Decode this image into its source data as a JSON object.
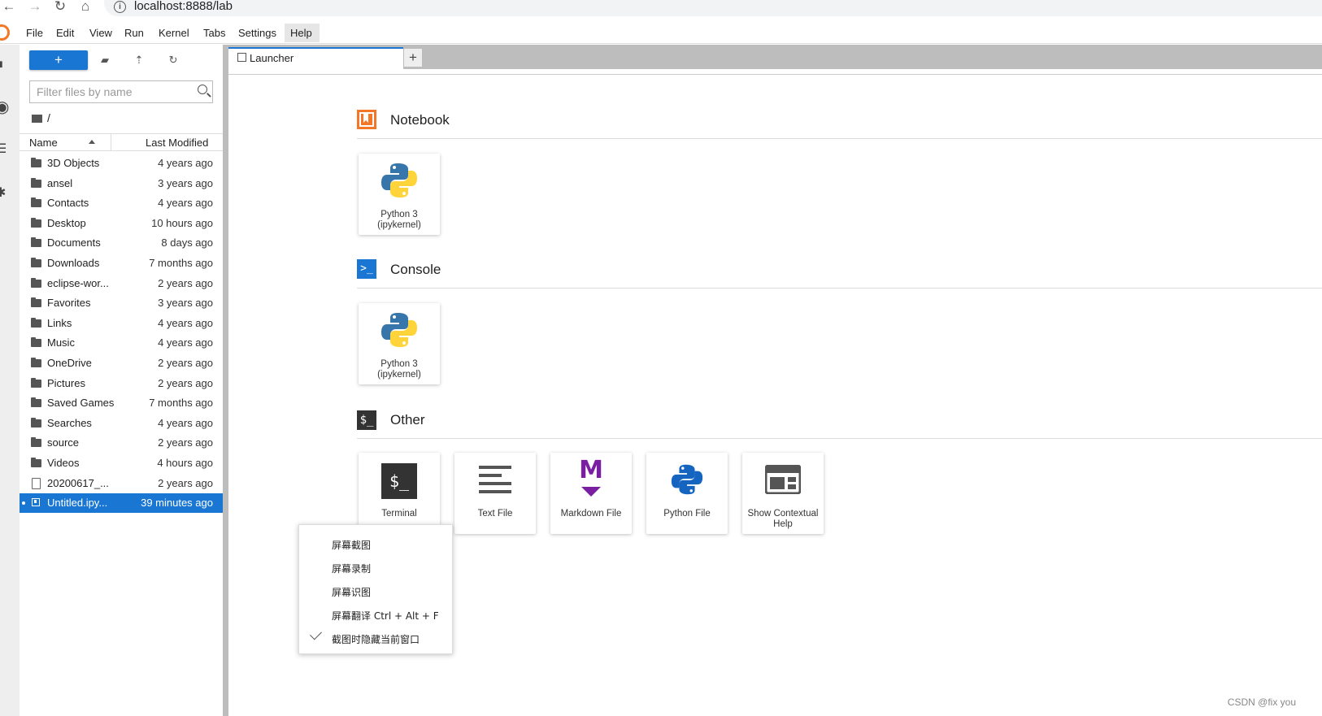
{
  "browser": {
    "url": "localhost:8888/lab"
  },
  "menu": {
    "items": [
      "File",
      "Edit",
      "View",
      "Run",
      "Kernel",
      "Tabs",
      "Settings",
      "Help"
    ]
  },
  "filebrowser": {
    "new_label": "+",
    "filter_placeholder": "Filter files by name",
    "breadcrumb": "/",
    "columns": {
      "name": "Name",
      "modified": "Last Modified"
    },
    "files": [
      {
        "name": "3D Objects",
        "modified": "4 years ago",
        "type": "folder"
      },
      {
        "name": "ansel",
        "modified": "3 years ago",
        "type": "folder"
      },
      {
        "name": "Contacts",
        "modified": "4 years ago",
        "type": "folder"
      },
      {
        "name": "Desktop",
        "modified": "10 hours ago",
        "type": "folder"
      },
      {
        "name": "Documents",
        "modified": "8 days ago",
        "type": "folder"
      },
      {
        "name": "Downloads",
        "modified": "7 months ago",
        "type": "folder"
      },
      {
        "name": "eclipse-wor...",
        "modified": "2 years ago",
        "type": "folder"
      },
      {
        "name": "Favorites",
        "modified": "3 years ago",
        "type": "folder"
      },
      {
        "name": "Links",
        "modified": "4 years ago",
        "type": "folder"
      },
      {
        "name": "Music",
        "modified": "4 years ago",
        "type": "folder"
      },
      {
        "name": "OneDrive",
        "modified": "2 years ago",
        "type": "folder"
      },
      {
        "name": "Pictures",
        "modified": "2 years ago",
        "type": "folder"
      },
      {
        "name": "Saved Games",
        "modified": "7 months ago",
        "type": "folder"
      },
      {
        "name": "Searches",
        "modified": "4 years ago",
        "type": "folder"
      },
      {
        "name": "source",
        "modified": "2 years ago",
        "type": "folder"
      },
      {
        "name": "Videos",
        "modified": "4 hours ago",
        "type": "folder"
      },
      {
        "name": "20200617_...",
        "modified": "2 years ago",
        "type": "file"
      },
      {
        "name": "Untitled.ipy...",
        "modified": "39 minutes ago",
        "type": "notebook",
        "selected": true
      }
    ]
  },
  "tabs": {
    "launcher": "Launcher",
    "add": "+"
  },
  "launcher": {
    "notebook": {
      "title": "Notebook",
      "cards": [
        {
          "line1": "Python 3",
          "line2": "(ipykernel)"
        }
      ]
    },
    "console": {
      "title": "Console",
      "cards": [
        {
          "line1": "Python 3",
          "line2": "(ipykernel)"
        }
      ]
    },
    "other": {
      "title": "Other",
      "icon_text": "$_",
      "cards": [
        {
          "label": "Terminal",
          "icon_text": "$_"
        },
        {
          "label": "Text File"
        },
        {
          "label": "Markdown File",
          "icon_text": "M"
        },
        {
          "label": "Python File"
        },
        {
          "line1": "Show Contextual",
          "line2": "Help"
        }
      ]
    }
  },
  "context_menu": {
    "items": [
      "屏幕截图",
      "屏幕录制",
      "屏幕识图",
      "屏幕翻译 Ctrl + Alt + F",
      "截图时隐藏当前窗口"
    ]
  },
  "watermark": "CSDN @fix you",
  "colors": {
    "accent": "#1976d2",
    "jupyter_orange": "#f37726",
    "markdown_purple": "#7b1fa2"
  }
}
